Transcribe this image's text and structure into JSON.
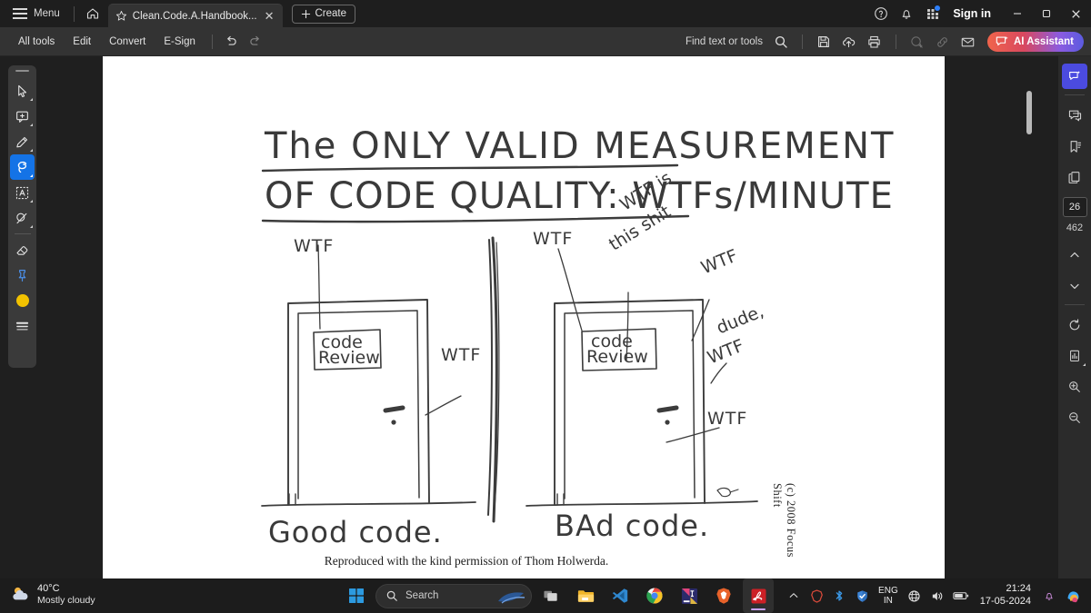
{
  "window": {
    "menu_label": "Menu",
    "home_icon": "home-icon",
    "tab": {
      "title": "Clean.Code.A.Handbook...",
      "star_icon": "star-icon",
      "close_icon": "close-icon"
    },
    "create_label": "Create",
    "sign_in_label": "Sign in",
    "help_icon": "help-icon",
    "bell_icon": "bell-icon",
    "apps_icon": "apps-grid-icon",
    "minimize_icon": "minimize-icon",
    "maximize_icon": "maximize-icon",
    "close_icon": "window-close-icon"
  },
  "toolbar": {
    "items": [
      {
        "label": "All tools"
      },
      {
        "label": "Edit"
      },
      {
        "label": "Convert"
      },
      {
        "label": "E-Sign"
      }
    ],
    "undo_icon": "undo-icon",
    "redo_icon": "redo-icon",
    "find_label": "Find text or tools",
    "search_icon": "search-icon",
    "save_icon": "save-icon",
    "upload_icon": "cloud-upload-icon",
    "print_icon": "print-icon",
    "stamp_icon": "add-stamp-icon",
    "link_icon": "link-icon",
    "mail_icon": "mail-icon",
    "ai_label": "AI Assistant",
    "ai_icon": "ai-sparkle-icon",
    "ai_gradient_from": "#f0644b",
    "ai_gradient_to": "#5b5be0"
  },
  "left_tools": [
    {
      "name": "select-tool",
      "icon": "cursor-icon",
      "active": false
    },
    {
      "name": "comment-tool",
      "icon": "comment-icon",
      "active": false
    },
    {
      "name": "draw-tool",
      "icon": "pencil-icon",
      "active": false
    },
    {
      "name": "lasso-tool",
      "icon": "lasso-icon",
      "active": true
    },
    {
      "name": "text-box-tool",
      "icon": "text-box-icon",
      "active": false
    },
    {
      "name": "shapes-tool",
      "icon": "shapes-icon",
      "active": false
    },
    {
      "name": "eraser-tool",
      "icon": "eraser-icon",
      "active": false
    },
    {
      "name": "pin-tool",
      "icon": "pin-icon",
      "active": false
    },
    {
      "name": "color-swatch",
      "icon": "color-circle-icon",
      "active": false
    },
    {
      "name": "thickness-tool",
      "icon": "line-weight-icon",
      "active": false
    }
  ],
  "right_panel": {
    "ai_icon": "ai-assistant-icon",
    "comment_icon": "comment-panel-icon",
    "bookmark_icon": "bookmark-icon",
    "pages_icon": "page-thumbnails-icon",
    "current_page": "26",
    "total_pages": "462",
    "prev_icon": "chevron-up-icon",
    "next_icon": "chevron-down-icon",
    "rotate_icon": "rotate-icon",
    "fit_icon": "fit-page-icon",
    "zoom_in_icon": "zoom-in-icon",
    "zoom_out_icon": "zoom-out-icon"
  },
  "document": {
    "title_line1": "The ONLY VALID MEASUREMENT",
    "title_line2": "OF CODE QUALITY: WTFs/MINUTE",
    "left_panel": {
      "caption": "Good code.",
      "sign": {
        "line1": "code",
        "line2": "Review"
      },
      "labels": [
        {
          "text": "WTF"
        },
        {
          "text": "WTF"
        }
      ]
    },
    "right_panel": {
      "caption": "BAd code.",
      "sign": {
        "line1": "code",
        "line2": "Review"
      },
      "labels": [
        {
          "text": "WTF"
        },
        {
          "text": "WTF is"
        },
        {
          "text": "this shit"
        },
        {
          "text": "WTF"
        },
        {
          "text": "dude,"
        },
        {
          "text": "WTF"
        },
        {
          "text": "WTF"
        }
      ]
    },
    "permission_caption": "Reproduced with the kind permission of Thom Holwerda.",
    "copyright": "(c) 2008 Focus Shift"
  },
  "taskbar": {
    "weather": {
      "temp": "40°C",
      "desc": "Mostly cloudy",
      "icon": "weather-cloudy-icon"
    },
    "start_icon": "windows-start-icon",
    "search_placeholder": "Search",
    "search_icon": "search-icon",
    "apps": [
      {
        "name": "task-view",
        "icon": "task-view-icon"
      },
      {
        "name": "file-explorer",
        "icon": "folder-icon"
      },
      {
        "name": "vs-code",
        "icon": "vscode-icon"
      },
      {
        "name": "chrome",
        "icon": "chrome-icon"
      },
      {
        "name": "intellij",
        "icon": "intellij-icon"
      },
      {
        "name": "brave",
        "icon": "brave-icon"
      },
      {
        "name": "acrobat",
        "icon": "acrobat-icon"
      }
    ],
    "tray": {
      "overflow_icon": "chevron-up-icon",
      "brave_icon": "brave-tray-icon",
      "bluetooth_icon": "bluetooth-icon",
      "defender_icon": "defender-shield-icon",
      "lang_line1": "ENG",
      "lang_line2": "IN",
      "network_icon": "network-icon",
      "volume_icon": "volume-icon",
      "battery_icon": "battery-icon",
      "time": "21:24",
      "date": "17-05-2024",
      "notification_icon": "notification-bell-icon",
      "copilot_icon": "copilot-icon"
    }
  }
}
